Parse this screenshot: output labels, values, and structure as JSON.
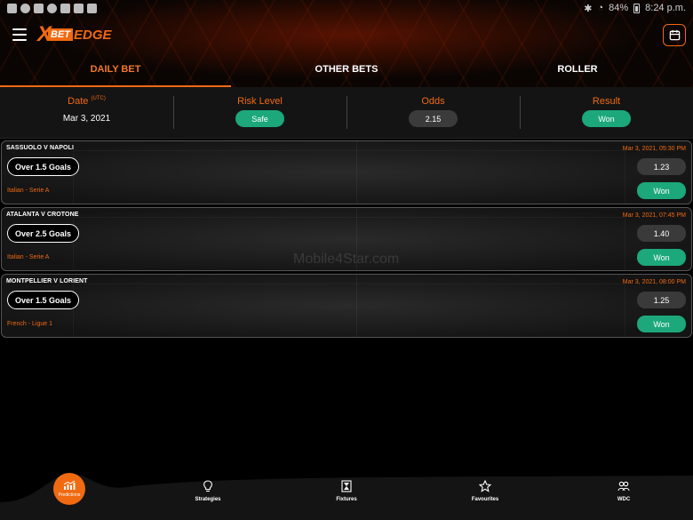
{
  "status_bar": {
    "battery": "84%",
    "time": "8:24 p.m."
  },
  "brand": {
    "x": "X",
    "bet": "BET",
    "edge": "EDGE",
    "accent_color": "#f06a12"
  },
  "tabs": [
    {
      "label": "DAILY BET",
      "active": true
    },
    {
      "label": "OTHER BETS",
      "active": false
    },
    {
      "label": "ROLLER",
      "active": false
    }
  ],
  "summary": {
    "date_label": "Date",
    "date_suffix": "(UTC)",
    "date_value": "Mar 3, 2021",
    "risk_label": "Risk Level",
    "risk_value": "Safe",
    "odds_label": "Odds",
    "odds_value": "2.15",
    "result_label": "Result",
    "result_value": "Won"
  },
  "matches": [
    {
      "title": "SASSUOLO V NAPOLI",
      "time": "Mar 3, 2021, 05:30 PM",
      "tip": "Over 1.5 Goals",
      "league": "Italian - Serie A",
      "odds": "1.23",
      "result": "Won"
    },
    {
      "title": "ATALANTA V CROTONE",
      "time": "Mar 3, 2021, 07:45 PM",
      "tip": "Over 2.5 Goals",
      "league": "Italian - Serie A",
      "odds": "1.40",
      "result": "Won"
    },
    {
      "title": "MONTPELLIER V LORIENT",
      "time": "Mar 3, 2021, 08:00 PM",
      "tip": "Over 1.5 Goals",
      "league": "French - Ligue 1",
      "odds": "1.25",
      "result": "Won"
    }
  ],
  "watermark": "Mobile4Star.com",
  "bottom_nav": {
    "predictions": "Predictions",
    "strategies": "Strategies",
    "fixtures": "Fixtures",
    "favourites": "Favourites",
    "wdc": "WDC"
  },
  "icons": {
    "menu": "menu-icon",
    "calendar": "calendar-icon",
    "predictions": "chart-icon",
    "strategies": "lightbulb-icon",
    "fixtures": "fixtures-icon",
    "favourites": "star-icon",
    "wdc": "group-icon"
  }
}
